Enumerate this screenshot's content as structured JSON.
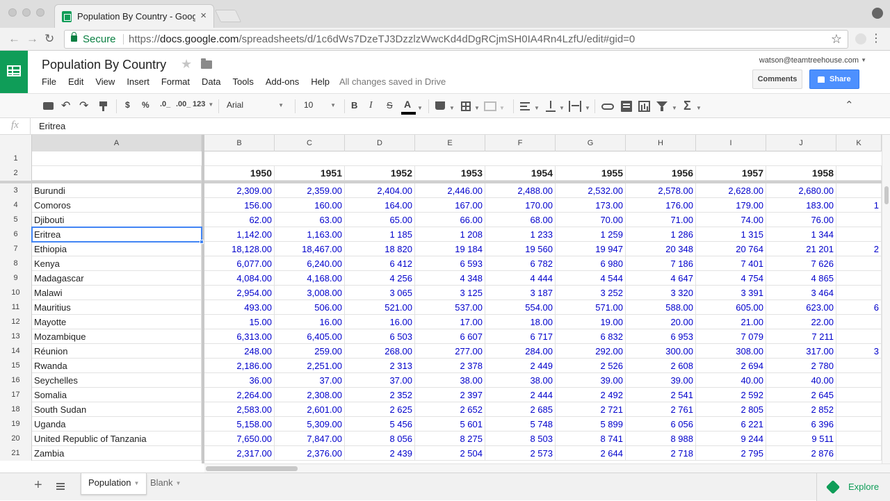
{
  "browser": {
    "tab_title": "Population By Country - Google Sheets",
    "tab_close": "×",
    "secure_label": "Secure",
    "url_scheme": "https://",
    "url_host": "docs.google.com",
    "url_path": "/spreadsheets/d/1c6dWs7DzeTJ3DzzlzWwcKd4dDgRCjmSH0IA4Rn4LzfU/edit#gid=0"
  },
  "header": {
    "title": "Population By Country",
    "menu": [
      "File",
      "Edit",
      "View",
      "Insert",
      "Format",
      "Data",
      "Tools",
      "Add-ons",
      "Help"
    ],
    "save_status": "All changes saved in Drive",
    "account": "watson@teamtreehouse.com",
    "comments_label": "Comments",
    "share_label": "Share",
    "accent_color": "#4d90fe",
    "brand_color": "#0f9d58"
  },
  "toolbar": {
    "currency": "$",
    "percent": "%",
    "decrease_decimal": ".0_",
    "increase_decimal": ".00_",
    "number_format": "123",
    "font": "Arial",
    "font_size": "10",
    "bold": "B",
    "italic": "I",
    "strike": "S",
    "text_color": "A"
  },
  "formula_bar": {
    "fx": "fx",
    "value": "Eritrea"
  },
  "grid": {
    "columns": [
      "A",
      "B",
      "C",
      "D",
      "E",
      "F",
      "G",
      "H",
      "I",
      "J",
      "K"
    ],
    "selected_column": "A",
    "selected_cell": "A6",
    "header_row": [
      "",
      "1950",
      "1951",
      "1952",
      "1953",
      "1954",
      "1955",
      "1956",
      "1957",
      "1958",
      ""
    ],
    "rows": [
      {
        "n": "3",
        "cells": [
          "Burundi",
          "2,309.00",
          "2,359.00",
          "2,404.00",
          "2,446.00",
          "2,488.00",
          "2,532.00",
          "2,578.00",
          "2,628.00",
          "2,680.00",
          ""
        ]
      },
      {
        "n": "4",
        "cells": [
          "Comoros",
          "156.00",
          "160.00",
          "164.00",
          "167.00",
          "170.00",
          "173.00",
          "176.00",
          "179.00",
          "183.00",
          "1"
        ]
      },
      {
        "n": "5",
        "cells": [
          "Djibouti",
          "62.00",
          "63.00",
          "65.00",
          "66.00",
          "68.00",
          "70.00",
          "71.00",
          "74.00",
          "76.00",
          ""
        ]
      },
      {
        "n": "6",
        "cells": [
          "Eritrea",
          "1,142.00",
          "1,163.00",
          "1 185",
          "1 208",
          "1 233",
          "1 259",
          "1 286",
          "1 315",
          "1 344",
          ""
        ]
      },
      {
        "n": "7",
        "cells": [
          "Ethiopia",
          "18,128.00",
          "18,467.00",
          "18 820",
          "19 184",
          "19 560",
          "19 947",
          "20 348",
          "20 764",
          "21 201",
          "2"
        ]
      },
      {
        "n": "8",
        "cells": [
          "Kenya",
          "6,077.00",
          "6,240.00",
          "6 412",
          "6 593",
          "6 782",
          "6 980",
          "7 186",
          "7 401",
          "7 626",
          ""
        ]
      },
      {
        "n": "9",
        "cells": [
          "Madagascar",
          "4,084.00",
          "4,168.00",
          "4 256",
          "4 348",
          "4 444",
          "4 544",
          "4 647",
          "4 754",
          "4 865",
          ""
        ]
      },
      {
        "n": "10",
        "cells": [
          "Malawi",
          "2,954.00",
          "3,008.00",
          "3 065",
          "3 125",
          "3 187",
          "3 252",
          "3 320",
          "3 391",
          "3 464",
          ""
        ]
      },
      {
        "n": "11",
        "cells": [
          "Mauritius",
          "493.00",
          "506.00",
          "521.00",
          "537.00",
          "554.00",
          "571.00",
          "588.00",
          "605.00",
          "623.00",
          "6"
        ]
      },
      {
        "n": "12",
        "cells": [
          "Mayotte",
          "15.00",
          "16.00",
          "16.00",
          "17.00",
          "18.00",
          "19.00",
          "20.00",
          "21.00",
          "22.00",
          ""
        ]
      },
      {
        "n": "13",
        "cells": [
          "Mozambique",
          "6,313.00",
          "6,405.00",
          "6 503",
          "6 607",
          "6 717",
          "6 832",
          "6 953",
          "7 079",
          "7 211",
          ""
        ]
      },
      {
        "n": "14",
        "cells": [
          "Réunion",
          "248.00",
          "259.00",
          "268.00",
          "277.00",
          "284.00",
          "292.00",
          "300.00",
          "308.00",
          "317.00",
          "3"
        ]
      },
      {
        "n": "15",
        "cells": [
          "Rwanda",
          "2,186.00",
          "2,251.00",
          "2 313",
          "2 378",
          "2 449",
          "2 526",
          "2 608",
          "2 694",
          "2 780",
          ""
        ]
      },
      {
        "n": "16",
        "cells": [
          "Seychelles",
          "36.00",
          "37.00",
          "37.00",
          "38.00",
          "38.00",
          "39.00",
          "39.00",
          "40.00",
          "40.00",
          ""
        ]
      },
      {
        "n": "17",
        "cells": [
          "Somalia",
          "2,264.00",
          "2,308.00",
          "2 352",
          "2 397",
          "2 444",
          "2 492",
          "2 541",
          "2 592",
          "2 645",
          ""
        ]
      },
      {
        "n": "18",
        "cells": [
          "South Sudan",
          "2,583.00",
          "2,601.00",
          "2 625",
          "2 652",
          "2 685",
          "2 721",
          "2 761",
          "2 805",
          "2 852",
          ""
        ]
      },
      {
        "n": "19",
        "cells": [
          "Uganda",
          "5,158.00",
          "5,309.00",
          "5 456",
          "5 601",
          "5 748",
          "5 899",
          "6 056",
          "6 221",
          "6 396",
          ""
        ]
      },
      {
        "n": "20",
        "cells": [
          "United Republic of Tanzania",
          "7,650.00",
          "7,847.00",
          "8 056",
          "8 275",
          "8 503",
          "8 741",
          "8 988",
          "9 244",
          "9 511",
          ""
        ]
      },
      {
        "n": "21",
        "cells": [
          "Zambia",
          "2,317.00",
          "2,376.00",
          "2 439",
          "2 504",
          "2 573",
          "2 644",
          "2 718",
          "2 795",
          "2 876",
          ""
        ]
      }
    ]
  },
  "sheets": {
    "tabs": [
      "Population",
      "Blank"
    ],
    "active": "Population",
    "explore_label": "Explore"
  }
}
